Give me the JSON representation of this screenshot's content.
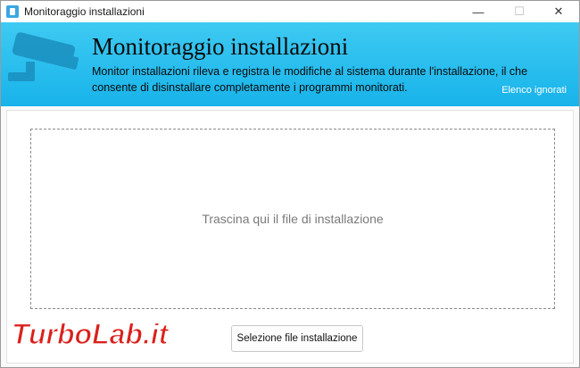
{
  "window": {
    "title": "Monitoraggio installazioni",
    "minimize_glyph": "—",
    "maximize_glyph": "☐",
    "close_glyph": "✕"
  },
  "banner": {
    "title": "Monitoraggio installazioni",
    "description": "Monitor installazioni rileva e registra le modifiche al sistema durante l'installazione, il che consente di disinstallare completamente i programmi monitorati.",
    "ignored_link": "Elenco ignorati",
    "icon": "security-camera-icon",
    "gradient_top": "#3ecaf2",
    "gradient_bottom": "#18b3ea"
  },
  "main": {
    "dropzone_text": "Trascina qui il file di installazione",
    "select_button_label": "Selezione file installazione"
  },
  "watermark": {
    "text": "TurboLab.it"
  }
}
